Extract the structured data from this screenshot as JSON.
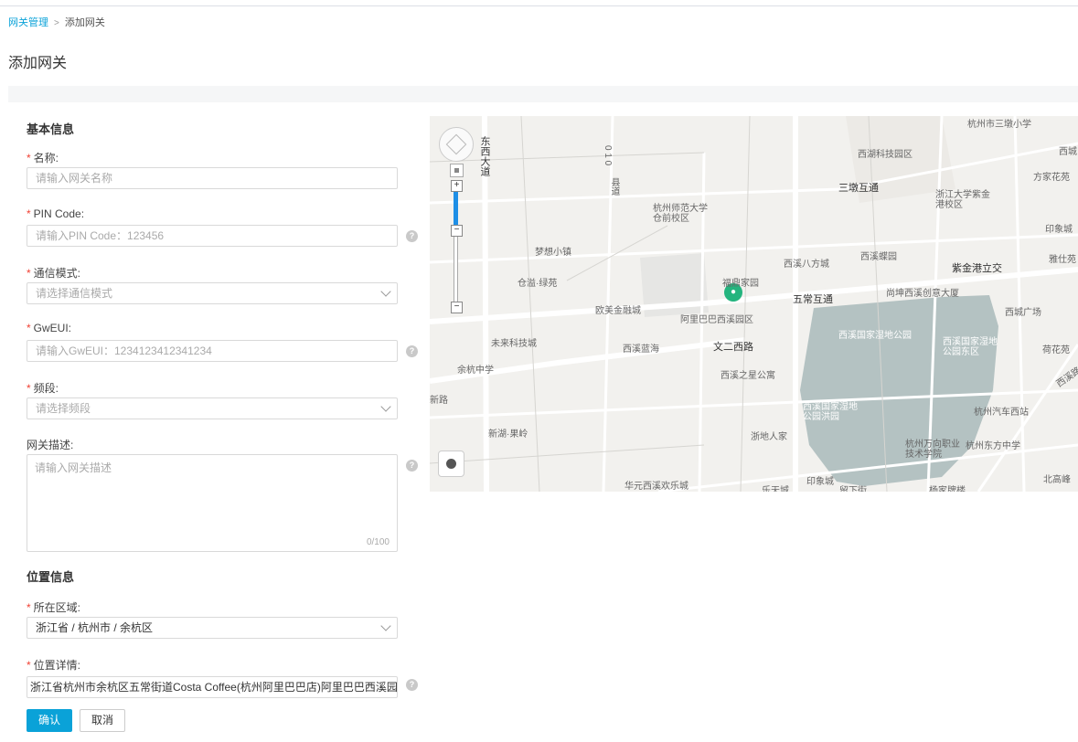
{
  "breadcrumb": {
    "parent": "网关管理",
    "separator": ">",
    "current": "添加网关"
  },
  "page_title": "添加网关",
  "basic_section": "基本信息",
  "fields": {
    "name": {
      "label": "名称:",
      "placeholder": "请输入网关名称"
    },
    "pin": {
      "label": "PIN Code:",
      "placeholder": "请输入PIN Code：123456"
    },
    "mode": {
      "label": "通信模式:",
      "placeholder": "请选择通信模式"
    },
    "gweui": {
      "label": "GwEUI:",
      "placeholder": "请输入GwEUI：1234123412341234"
    },
    "band": {
      "label": "频段:",
      "placeholder": "请选择频段"
    },
    "desc": {
      "label": "网关描述:",
      "placeholder": "请输入网关描述",
      "counter": "0/100"
    }
  },
  "location_section": "位置信息",
  "location": {
    "region": {
      "label": "所在区域:",
      "value": "浙江省 / 杭州市 / 余杭区"
    },
    "detail": {
      "label": "位置详情:",
      "value": "浙江省杭州市余杭区五常街道Costa Coffee(杭州阿里巴巴店)阿里巴巴西溪园"
    }
  },
  "buttons": {
    "confirm": "确认",
    "cancel": "取消"
  },
  "required_mark": "*",
  "help_glyph": "?",
  "map": {
    "labels": [
      "杭州市三墩小学",
      "西湖科技园区",
      "三墩互通",
      "浙江大学紫金港校区",
      "方家花苑",
      "西城",
      "印象城",
      "东西大道",
      "县道",
      "杭州师范大学仓前校区",
      "梦想小镇",
      "仓溢·绿苑",
      "西溪八方城",
      "西溪蝶园",
      "紫金港立交",
      "雅仕苑",
      "福鼎家园",
      "五常互通",
      "尚坤西溪创意大厦",
      "欧美金融城",
      "阿里巴巴西溪园区",
      "西城广场",
      "西溪国家湿地公园",
      "未来科技城",
      "西溪蓝海",
      "文二西路",
      "西溪国家湿地公园东区",
      "荷花苑",
      "余杭中学",
      "西溪之星公寓",
      "新路",
      "西溪国家湿地公园洪园",
      "杭州汽车西站",
      "新湖·果岭",
      "浙地人家",
      "杭州万向职业技术学院",
      "杭州东方中学",
      "华元西溪欢乐城",
      "乐天城",
      "印象城",
      "留下街",
      "杨家牌楼",
      "北高峰",
      "西溪路"
    ],
    "road_010": "0 1 0"
  },
  "colors": {
    "accent": "#0aa2d8",
    "required": "#f04134",
    "marker": "#24b47e",
    "wetland": "#9fb2b3"
  }
}
